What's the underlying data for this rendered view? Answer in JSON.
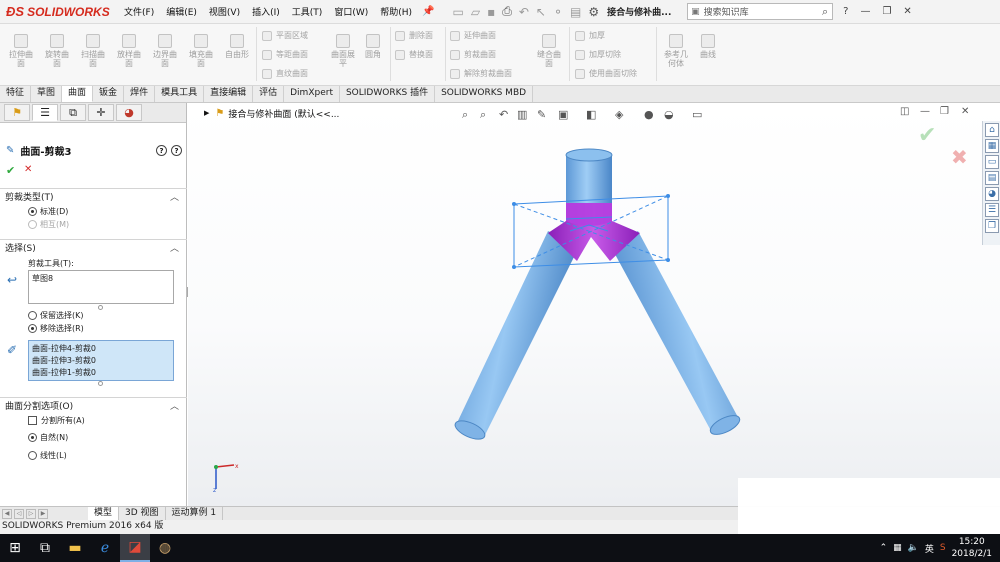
{
  "app": {
    "logo_text": "SOLIDWORKS",
    "doc_title": "接合与修补曲..."
  },
  "menu": [
    "文件(F)",
    "编辑(E)",
    "视图(V)",
    "插入(I)",
    "工具(T)",
    "窗口(W)",
    "帮助(H)"
  ],
  "search": {
    "placeholder": "搜索知识库"
  },
  "ribbon": {
    "big_buttons": [
      {
        "label": "拉伸曲\n面"
      },
      {
        "label": "旋转曲\n面"
      },
      {
        "label": "扫描曲\n面"
      },
      {
        "label": "放样曲\n面"
      },
      {
        "label": "边界曲\n面"
      },
      {
        "label": "填充曲\n面"
      },
      {
        "label": "自由形"
      },
      {
        "label": "曲面展\n平"
      },
      {
        "label": "圆角"
      },
      {
        "label": "缝合曲\n面"
      },
      {
        "label": "参考几\n何体"
      },
      {
        "label": "曲线"
      }
    ],
    "small_buttons": [
      "平面区域",
      "等距曲面",
      "直纹曲面",
      "删除面",
      "替换面",
      "延伸曲面",
      "剪裁曲面",
      "解除剪裁曲面",
      "加厚",
      "加厚切除",
      "使用曲面切除"
    ]
  },
  "tabs": [
    {
      "label": "特征",
      "active": false
    },
    {
      "label": "草图",
      "active": false
    },
    {
      "label": "曲面",
      "active": true
    },
    {
      "label": "钣金",
      "active": false
    },
    {
      "label": "焊件",
      "active": false
    },
    {
      "label": "模具工具",
      "active": false
    },
    {
      "label": "直接编辑",
      "active": false
    },
    {
      "label": "评估",
      "active": false
    },
    {
      "label": "DimXpert",
      "active": false
    },
    {
      "label": "SOLIDWORKS 插件",
      "active": false
    },
    {
      "label": "SOLIDWORKS MBD",
      "active": false
    }
  ],
  "panel": {
    "title": "曲面-剪裁3",
    "trim_type": {
      "header": "剪裁类型(T)",
      "options": [
        {
          "label": "标准(D)",
          "selected": true,
          "enabled": true
        },
        {
          "label": "相互(M)",
          "selected": false,
          "enabled": false
        }
      ]
    },
    "selections": {
      "header": "选择(S)",
      "tool_label": "剪裁工具(T):",
      "tool_value": "草图8",
      "options": [
        {
          "label": "保留选择(K)",
          "selected": false
        },
        {
          "label": "移除选择(R)",
          "selected": true
        }
      ],
      "pieces": [
        "曲面-拉伸4-剪裁0",
        "曲面-拉伸3-剪裁0",
        "曲面-拉伸1-剪裁0"
      ]
    },
    "split": {
      "header": "曲面分割选项(O)",
      "split_all": {
        "label": "分割所有(A)",
        "checked": false
      },
      "options": [
        {
          "label": "自然(N)",
          "selected": true
        },
        {
          "label": "线性(L)",
          "selected": false
        }
      ]
    }
  },
  "viewport": {
    "breadcrumb": "接合与修补曲面  (默认<<..."
  },
  "bottom_tabs": [
    {
      "label": "模型",
      "active": true
    },
    {
      "label": "3D 视图",
      "active": false
    },
    {
      "label": "运动算例 1",
      "active": false
    }
  ],
  "status": {
    "text": "SOLIDWORKS Premium 2016 x64 版"
  },
  "taskbar": {
    "time": "15:20",
    "date": "2018/2/1",
    "ime": "英"
  },
  "colors": {
    "surface_blue": "#6aa6e2",
    "trim_purple": "#a52fd1",
    "sketch_blue": "#3d8de6",
    "brand_red": "#d52b1e"
  }
}
